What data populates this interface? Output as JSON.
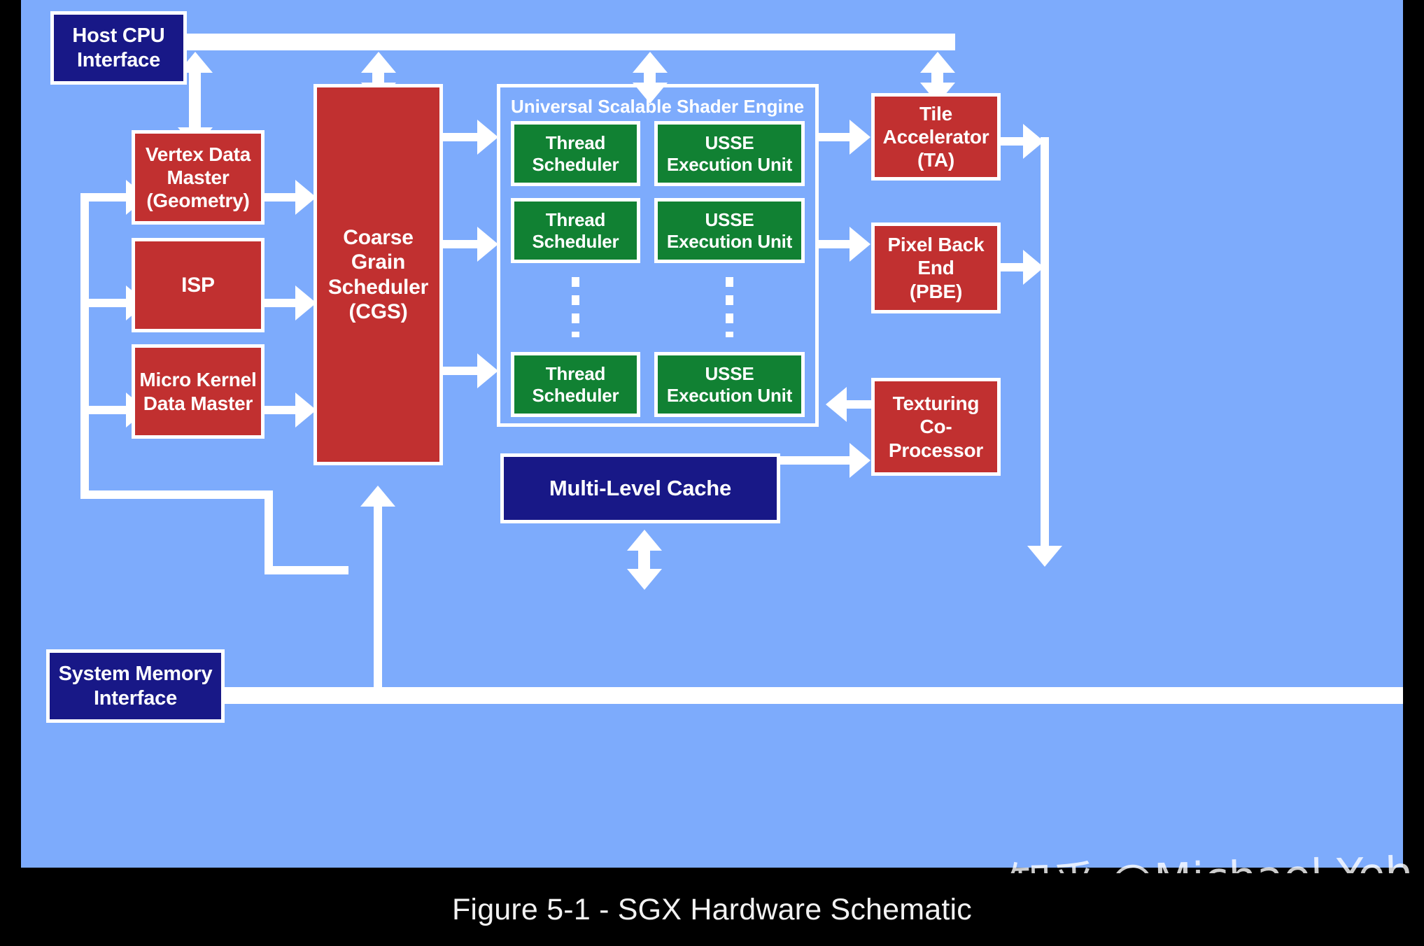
{
  "figure": {
    "caption": "Figure 5-1 - SGX Hardware Schematic",
    "watermark": "知乎 @Michael Yeh"
  },
  "colors": {
    "background": "#7dabfc",
    "navy": "#181887",
    "red": "#c13030",
    "green": "#118133",
    "connector": "#ffffff",
    "caption_background": "#000000"
  },
  "interfaces": {
    "host_cpu": "Host CPU\nInterface",
    "system_memory": "System Memory\nInterface"
  },
  "data_masters": [
    {
      "label": "Vertex Data\nMaster\n(Geometry)"
    },
    {
      "label": "ISP"
    },
    {
      "label": "Micro Kernel\nData Master"
    }
  ],
  "scheduler": {
    "label": "Coarse\nGrain\nScheduler\n(CGS)"
  },
  "shader_engine": {
    "title": "Universal Scalable Shader Engine",
    "rows": [
      {
        "scheduler": "Thread\nScheduler",
        "unit": "USSE\nExecution Unit"
      },
      {
        "scheduler": "Thread\nScheduler",
        "unit": "USSE\nExecution Unit"
      },
      {
        "scheduler": "Thread\nScheduler",
        "unit": "USSE\nExecution Unit"
      }
    ],
    "ellipsis": "vertical-ellipsis"
  },
  "backend_units": [
    {
      "label": "Tile\nAccelerator\n(TA)"
    },
    {
      "label": "Pixel Back\nEnd\n(PBE)"
    },
    {
      "label": "Texturing\nCo-\nProcessor"
    }
  ],
  "cache": {
    "label": "Multi-Level Cache"
  }
}
